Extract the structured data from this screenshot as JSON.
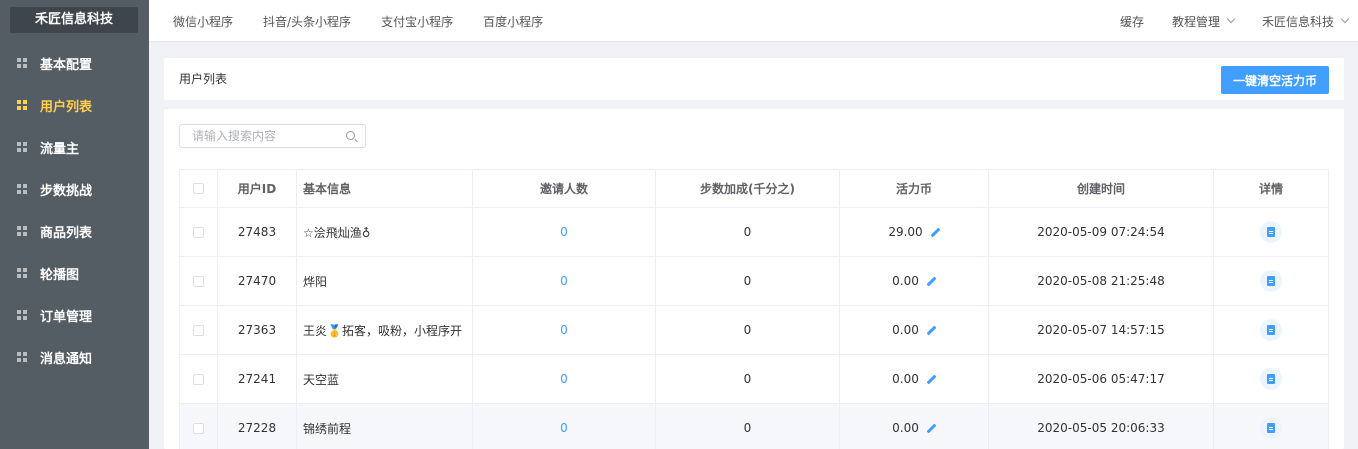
{
  "app": {
    "logo": "禾匠信息科技"
  },
  "sidebar": {
    "items": [
      {
        "label": "基本配置",
        "active": false
      },
      {
        "label": "用户列表",
        "active": true
      },
      {
        "label": "流量主",
        "active": false
      },
      {
        "label": "步数挑战",
        "active": false
      },
      {
        "label": "商品列表",
        "active": false
      },
      {
        "label": "轮播图",
        "active": false
      },
      {
        "label": "订单管理",
        "active": false
      },
      {
        "label": "消息通知",
        "active": false
      }
    ]
  },
  "topbar": {
    "tabs": [
      "微信小程序",
      "抖音/头条小程序",
      "支付宝小程序",
      "百度小程序"
    ],
    "cache": "缓存",
    "tutorial": "教程管理",
    "company": "禾匠信息科技"
  },
  "page": {
    "title": "用户列表",
    "clear_button": "一键清空活力币"
  },
  "search": {
    "placeholder": "请输入搜索内容"
  },
  "table": {
    "headers": [
      "用户ID",
      "基本信息",
      "邀请人数",
      "步数加成(千分之)",
      "活力币",
      "创建时间",
      "详情"
    ],
    "rows": [
      {
        "id": "27483",
        "info": "☆浍飛灿渔♁",
        "invites": "0",
        "bonus": "0",
        "coins": "29.00",
        "created": "2020-05-09 07:24:54"
      },
      {
        "id": "27470",
        "info": "烨阳",
        "invites": "0",
        "bonus": "0",
        "coins": "0.00",
        "created": "2020-05-08 21:25:48"
      },
      {
        "id": "27363",
        "info": "王炎🥇拓客，吸粉，小程序开",
        "invites": "0",
        "bonus": "0",
        "coins": "0.00",
        "created": "2020-05-07 14:57:15"
      },
      {
        "id": "27241",
        "info": "天空蓝",
        "invites": "0",
        "bonus": "0",
        "coins": "0.00",
        "created": "2020-05-06 05:47:17"
      },
      {
        "id": "27228",
        "info": "锦绣前程",
        "invites": "0",
        "bonus": "0",
        "coins": "0.00",
        "created": "2020-05-05 20:06:33"
      }
    ]
  }
}
